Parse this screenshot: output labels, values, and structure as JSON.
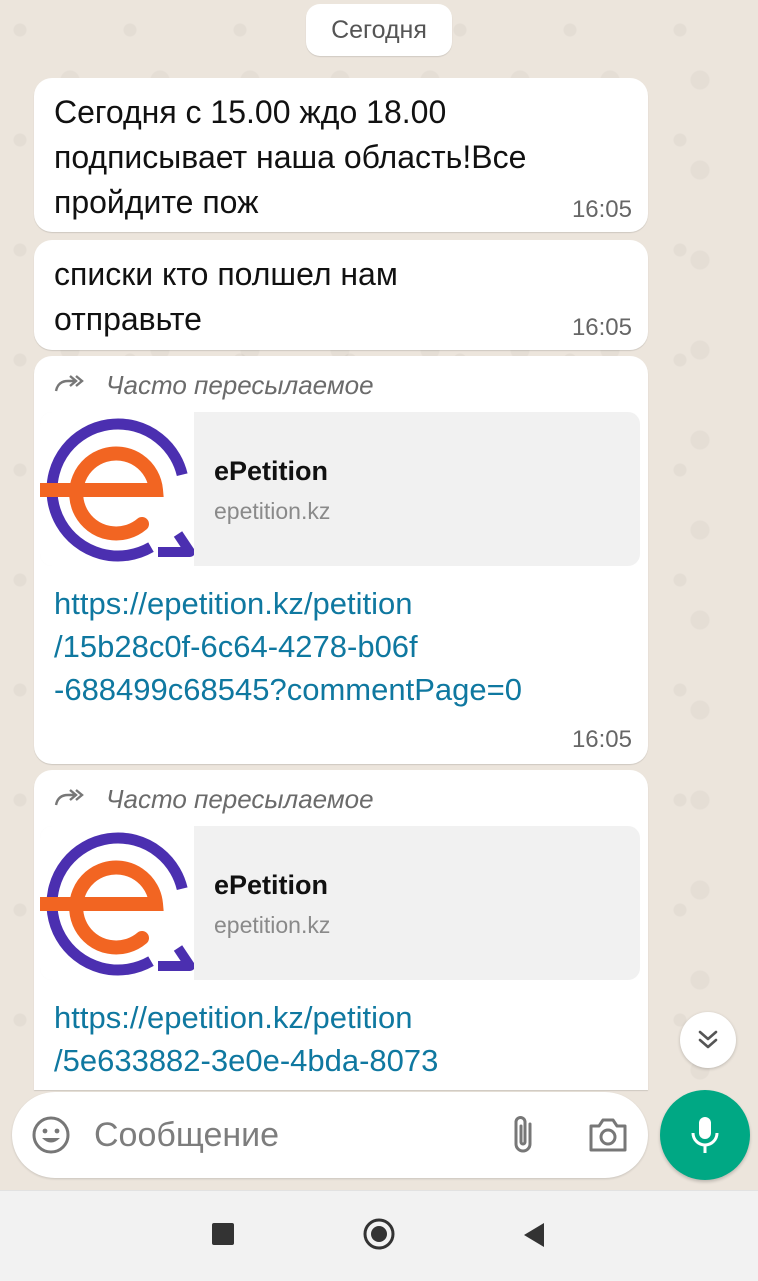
{
  "chat": {
    "date_label": "Сегодня",
    "messages": [
      {
        "text_lines": [
          "Сегодня с 15.00 ждо 18.00",
          "подписывает наша область!Все",
          "пройдите пож"
        ],
        "time": "16:05"
      },
      {
        "text_lines": [
          "списки кто полшел нам",
          "отправьте"
        ],
        "time": "16:05"
      },
      {
        "forwarded_label": "Часто пересылаемое",
        "preview": {
          "title": "ePetition",
          "domain": "epetition.kz"
        },
        "link_lines": [
          "https://epetition.kz/petition",
          "/15b28c0f-6c64-4278-b06f",
          "-688499c68545?commentPage=0"
        ],
        "time": "16:05"
      },
      {
        "forwarded_label": "Часто пересылаемое",
        "preview": {
          "title": "ePetition",
          "domain": "epetition.kz"
        },
        "link_lines": [
          "https://epetition.kz/petition",
          "/5e633882-3e0e-4bda-8073"
        ]
      }
    ]
  },
  "composer": {
    "placeholder": "Сообщение",
    "icons": {
      "emoji": "emoji-icon",
      "attach": "paperclip-icon",
      "camera": "camera-icon",
      "mic": "microphone-icon"
    }
  },
  "navbar": {
    "icons": [
      "square-recents-icon",
      "circle-home-icon",
      "triangle-back-icon"
    ]
  },
  "colors": {
    "accent": "#00a884",
    "link": "#0f78a0",
    "logo_orange": "#f26522",
    "logo_purple": "#4b2fb0"
  }
}
